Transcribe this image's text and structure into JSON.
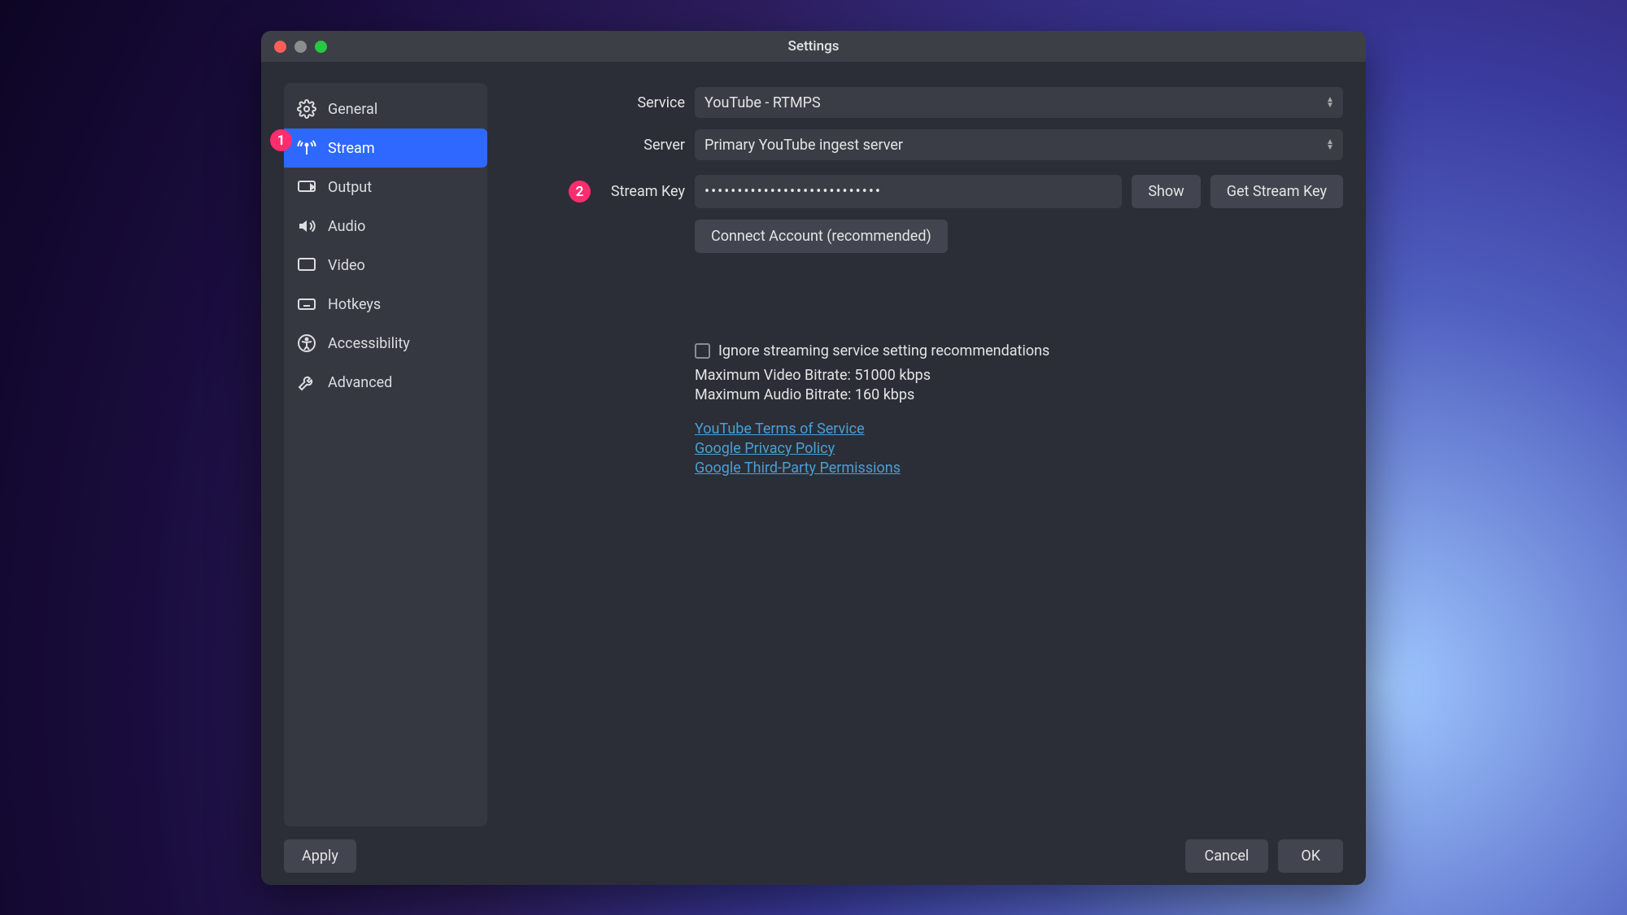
{
  "window": {
    "title": "Settings"
  },
  "sidebar": {
    "items": [
      {
        "label": "General"
      },
      {
        "label": "Stream"
      },
      {
        "label": "Output"
      },
      {
        "label": "Audio"
      },
      {
        "label": "Video"
      },
      {
        "label": "Hotkeys"
      },
      {
        "label": "Accessibility"
      },
      {
        "label": "Advanced"
      }
    ]
  },
  "form": {
    "service_label": "Service",
    "service_value": "YouTube - RTMPS",
    "server_label": "Server",
    "server_value": "Primary YouTube ingest server",
    "streamkey_label": "Stream Key",
    "streamkey_value": "•••••••••••••••••••••••••••",
    "show_btn": "Show",
    "getkey_btn": "Get Stream Key",
    "connect_btn": "Connect Account (recommended)",
    "ignore_label": "Ignore streaming service setting recommendations",
    "max_video": "Maximum Video Bitrate: 51000 kbps",
    "max_audio": "Maximum Audio Bitrate: 160 kbps",
    "link_tos": "YouTube Terms of Service",
    "link_privacy": "Google Privacy Policy",
    "link_thirdparty": "Google Third-Party Permissions"
  },
  "footer": {
    "apply": "Apply",
    "cancel": "Cancel",
    "ok": "OK"
  },
  "annotations": {
    "badge1": "1",
    "badge2": "2"
  }
}
